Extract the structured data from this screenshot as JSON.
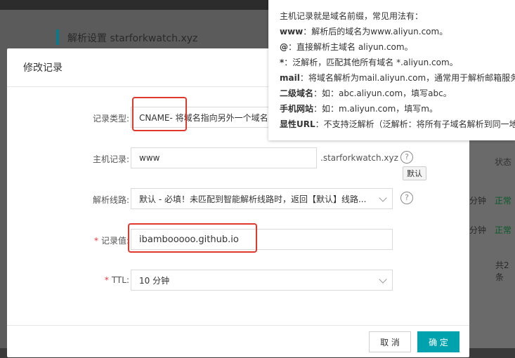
{
  "background": {
    "page_title": "解析设置 starforkwatch.xyz",
    "status_header": "状态",
    "rows": [
      {
        "ttl": "分钟",
        "status": "正常"
      },
      {
        "ttl": "分钟",
        "status": "正常"
      }
    ],
    "total": "共2条"
  },
  "modal": {
    "title": "修改记录",
    "fields": {
      "record_type": {
        "label": "记录类型:",
        "value": "CNAME- 将域名指向另外一个域名"
      },
      "host": {
        "label": "主机记录:",
        "value": "www",
        "suffix": ".starforkwatch.xyz"
      },
      "line": {
        "label": "解析线路:",
        "value": "默认 - 必填！未匹配到智能解析线路时，返回【默认】线路..."
      },
      "record_value": {
        "label": "记录值:",
        "required_mark": "*",
        "value": "ibambooooo.github.io"
      },
      "ttl": {
        "label": "TTL:",
        "required_mark": "*",
        "value": "10 分钟"
      }
    },
    "help_glyph": "?",
    "default_tooltip": "默认",
    "buttons": {
      "cancel": "取 消",
      "ok": "确 定"
    }
  },
  "popover": {
    "intro": "主机记录就是域名前缀，常见用法有：",
    "items": [
      {
        "key": "www",
        "text": "：解析后的域名为www.aliyun.com。"
      },
      {
        "key": "@",
        "text": "：直接解析主域名 aliyun.com。"
      },
      {
        "key": "*",
        "text": "：泛解析，匹配其他所有域名 *.aliyun.com。"
      },
      {
        "key": "mail",
        "text": "：将域名解析为mail.aliyun.com，通常用于解析邮箱服务器"
      },
      {
        "key": "二级域名",
        "text": "：如：abc.aliyun.com，填写abc。"
      },
      {
        "key": "手机网站",
        "text": "：如：m.aliyun.com，填写m。"
      },
      {
        "key": "显性URL",
        "text": "：不支持泛解析（泛解析：将所有子域名解析到同一地址）"
      }
    ]
  },
  "colors": {
    "accent": "#00a2ae",
    "highlight": "#e0392b",
    "required": "#e4393c",
    "status_ok": "#0a5a2a"
  }
}
